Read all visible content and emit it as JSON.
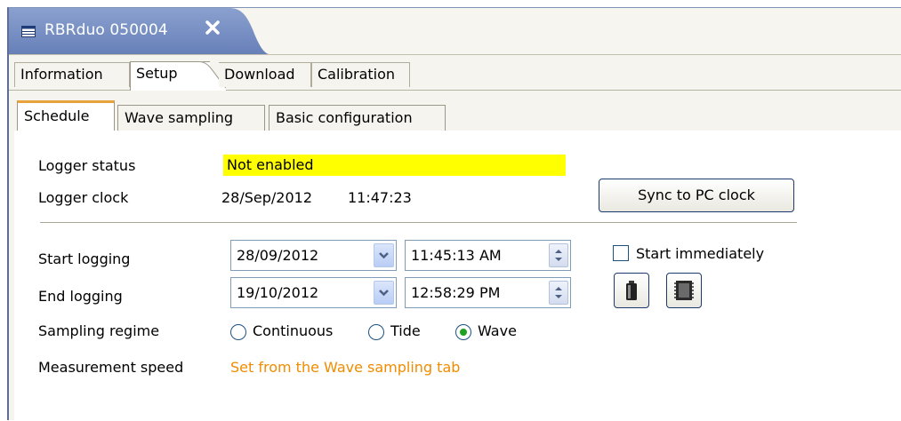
{
  "editor_tab": {
    "title": "RBRduo 050004"
  },
  "section_tabs": [
    {
      "label": "Information"
    },
    {
      "label": "Setup"
    },
    {
      "label": "Download"
    },
    {
      "label": "Calibration"
    }
  ],
  "inner_tabs": [
    {
      "label": "Schedule"
    },
    {
      "label": "Wave sampling"
    },
    {
      "label": "Basic configuration"
    }
  ],
  "schedule": {
    "logger_status_label": "Logger status",
    "logger_status_value": "Not enabled",
    "logger_clock_label": "Logger clock",
    "logger_clock_date": "28/Sep/2012",
    "logger_clock_time": "11:47:23",
    "sync_button": "Sync to PC clock",
    "start_label": "Start logging",
    "start_date": "28/09/2012",
    "start_time": "11:45:13 AM",
    "start_immediately_label": "Start immediately",
    "start_immediately_checked": false,
    "end_label": "End logging",
    "end_date": "19/10/2012",
    "end_time": "12:58:29 PM",
    "regime_label": "Sampling regime",
    "regime_options": [
      "Continuous",
      "Tide",
      "Wave"
    ],
    "regime_selected": "Wave",
    "speed_label": "Measurement speed",
    "speed_value": "Set from the Wave sampling tab"
  },
  "icons": {
    "editor_tab": "table-icon",
    "close": "close-icon",
    "battery": "battery-icon",
    "memory": "memory-chip-icon"
  },
  "colors": {
    "status_highlight": "#ffff00",
    "editor_tab_bg": "#6d86bd",
    "active_tab_accent": "#e8a23a",
    "note_text": "#f08c00"
  }
}
